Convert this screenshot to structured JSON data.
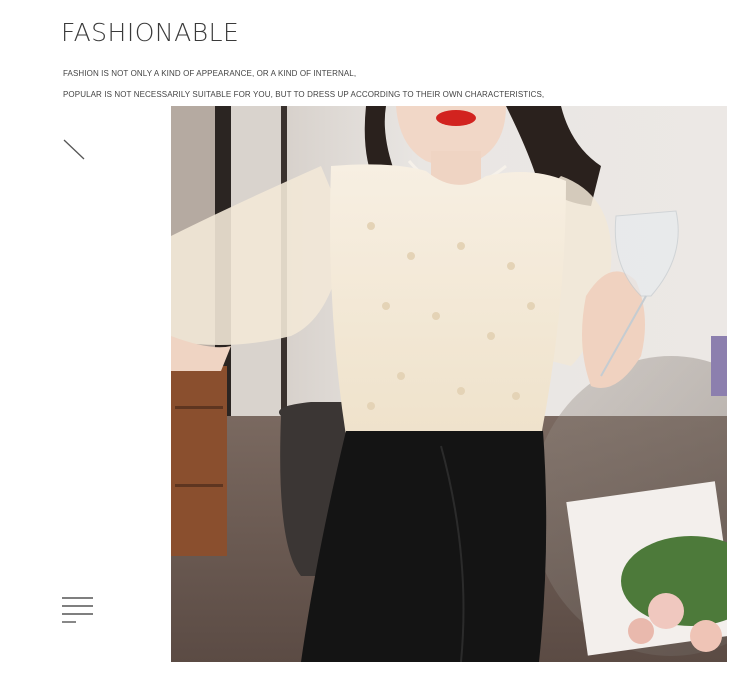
{
  "header": {
    "title": "FASHIONABLE",
    "line1": "FASHION IS NOT ONLY A KIND OF APPEARANCE, OR A KIND OF INTERNAL,",
    "line2": "POPULAR IS NOT NECESSARILY SUITABLE FOR YOU, BUT TO DRESS UP ACCORDING TO THEIR OWN CHARACTERISTICS,"
  },
  "icons": {
    "decor": "slash-line-icon",
    "menu": "menu-lines-icon"
  },
  "photo": {
    "subject": "woman-in-lace-blouse-photo",
    "colors": {
      "blouse": "#f3e7d3",
      "skirt": "#141414",
      "wall": "#e6e2de",
      "floor": "#6b5a52"
    }
  }
}
